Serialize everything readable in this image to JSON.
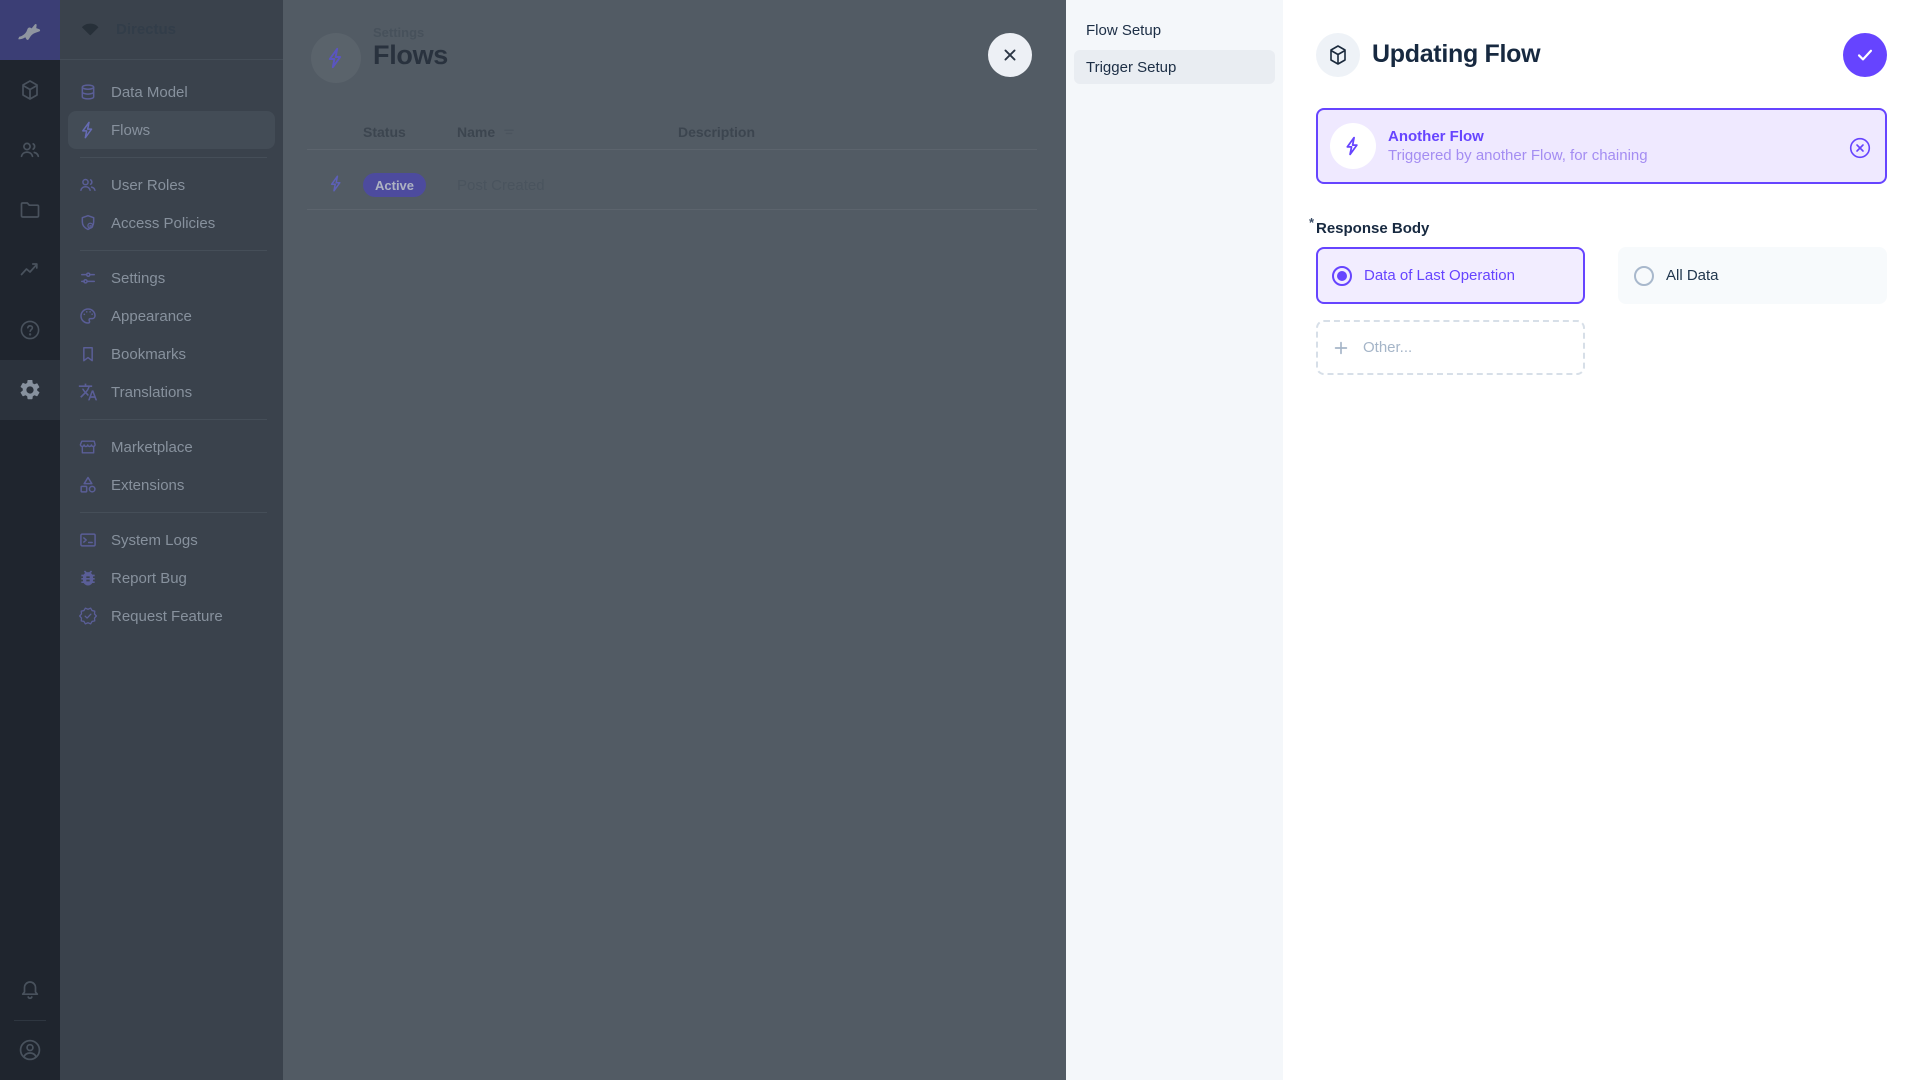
{
  "app": {
    "name": "Directus"
  },
  "colors": {
    "primary": "#6644ff",
    "primary_light_bg": "#efe9ff",
    "module_bar_bg": "#1f252e",
    "nav_bg": "#3a424c",
    "drawer_nav_bg": "#f4f7fa",
    "drawer_bg": "#ffffff",
    "dim_overlay_bg": "#525b64",
    "dark_text": "#172940"
  },
  "module_bar": {
    "modules": [
      {
        "name": "content",
        "icon": "cube-icon"
      },
      {
        "name": "users",
        "icon": "people-icon"
      },
      {
        "name": "files",
        "icon": "folder-icon"
      },
      {
        "name": "insights",
        "icon": "chart-icon"
      },
      {
        "name": "documentation",
        "icon": "help-icon"
      },
      {
        "name": "settings",
        "icon": "gear-icon",
        "active": true
      },
      {
        "name": "notifications",
        "icon": "bell-icon"
      },
      {
        "name": "user-menu",
        "icon": "avatar-icon"
      }
    ]
  },
  "nav": {
    "project_name": "Directus",
    "items": [
      {
        "label": "Data Model",
        "icon": "database-icon"
      },
      {
        "label": "Flows",
        "icon": "bolt-icon",
        "active": true
      },
      {
        "label": "User Roles",
        "icon": "people-icon"
      },
      {
        "label": "Access Policies",
        "icon": "shield-icon"
      },
      {
        "label": "Settings",
        "icon": "tune-icon"
      },
      {
        "label": "Appearance",
        "icon": "palette-icon"
      },
      {
        "label": "Bookmarks",
        "icon": "bookmark-icon"
      },
      {
        "label": "Translations",
        "icon": "translate-icon"
      },
      {
        "label": "Marketplace",
        "icon": "storefront-icon"
      },
      {
        "label": "Extensions",
        "icon": "category-icon"
      },
      {
        "label": "System Logs",
        "icon": "terminal-icon"
      },
      {
        "label": "Report Bug",
        "icon": "bug-icon"
      },
      {
        "label": "Request Feature",
        "icon": "feature-badge-icon"
      }
    ]
  },
  "main": {
    "breadcrumb": "Settings",
    "title": "Flows",
    "table": {
      "columns": [
        "Status",
        "Name",
        "Description"
      ]
    },
    "rows": [
      {
        "status": "Active",
        "name": "Post Created",
        "description": ""
      }
    ]
  },
  "drawer": {
    "nav": [
      {
        "label": "Flow Setup"
      },
      {
        "label": "Trigger Setup",
        "active": true
      }
    ],
    "title": "Updating Flow",
    "trigger_card": {
      "title": "Another Flow",
      "subtitle": "Triggered by another Flow, for chaining"
    },
    "response_body": {
      "label": "Response Body",
      "required_marker": "*",
      "options": [
        {
          "label": "Data of Last Operation",
          "selected": true
        },
        {
          "label": "All Data",
          "selected": false
        }
      ],
      "other_label": "Other..."
    }
  }
}
